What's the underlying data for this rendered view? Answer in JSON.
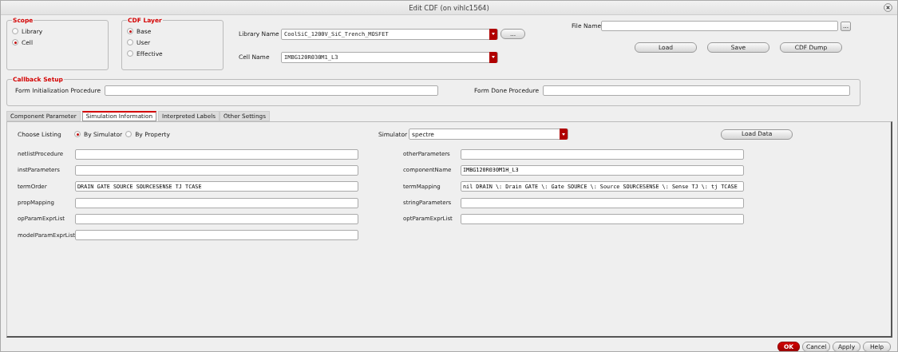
{
  "window": {
    "title": "Edit CDF (on vihlc1564)"
  },
  "scope": {
    "label": "Scope",
    "options": [
      {
        "label": "Library",
        "selected": false
      },
      {
        "label": "Cell",
        "selected": true
      }
    ]
  },
  "cdf_layer": {
    "label": "CDF Layer",
    "options": [
      {
        "label": "Base",
        "selected": true
      },
      {
        "label": "User",
        "selected": false
      },
      {
        "label": "Effective",
        "selected": false
      }
    ]
  },
  "library_name": {
    "label": "Library Name",
    "value": "CoolSiC_1200V_SiC_Trench_MOSFET",
    "button": "..."
  },
  "cell_name": {
    "label": "Cell Name",
    "value": "IMBG120R030M1_L3"
  },
  "file_name": {
    "label": "File Name",
    "button": "..."
  },
  "file_buttons": [
    "Load",
    "Save",
    "CDF Dump"
  ],
  "callback_setup": {
    "label": "Callback Setup",
    "fields": [
      {
        "label": "Form Initialization Procedure"
      },
      {
        "label": "Form Done Procedure"
      }
    ]
  },
  "tabs": [
    {
      "label": "Component Parameter",
      "selected": false
    },
    {
      "label": "Simulation Information",
      "selected": true
    },
    {
      "label": "Interpreted Labels",
      "selected": false
    },
    {
      "label": "Other Settings",
      "selected": false
    }
  ],
  "simulation": {
    "choose_listing": {
      "label": "Choose Listing",
      "options": [
        {
          "label": "By Simulator",
          "selected": true
        },
        {
          "label": "By Property",
          "selected": false
        }
      ]
    },
    "simulator": {
      "label": "Simulator",
      "value": "spectre"
    },
    "load_button": "Load Data",
    "left_fields": [
      {
        "label": "netlistProcedure"
      },
      {
        "label": "instParameters"
      },
      {
        "label": "termOrder",
        "value": "DRAIN GATE SOURCE SOURCESENSE TJ TCASE"
      },
      {
        "label": "propMapping"
      },
      {
        "label": "opParamExprList"
      },
      {
        "label": "modelParamExprList"
      }
    ],
    "right_fields": [
      {
        "label": "otherParameters"
      },
      {
        "label": "componentName",
        "value": "IMBG120R030M1H_L3"
      },
      {
        "label": "termMapping",
        "value": "nil DRAIN \\: Drain GATE \\: Gate SOURCE \\: Source SOURCESENSE \\: Sense TJ \\: tj TCASE"
      },
      {
        "label": "stringParameters"
      },
      {
        "label": "optParamExprList"
      }
    ]
  },
  "buttons": [
    {
      "label": "OK",
      "kind": "primary"
    },
    {
      "label": "Cancel",
      "kind": "normal"
    },
    {
      "label": "Apply",
      "kind": "normal"
    },
    {
      "label": "Help",
      "kind": "normal"
    }
  ]
}
